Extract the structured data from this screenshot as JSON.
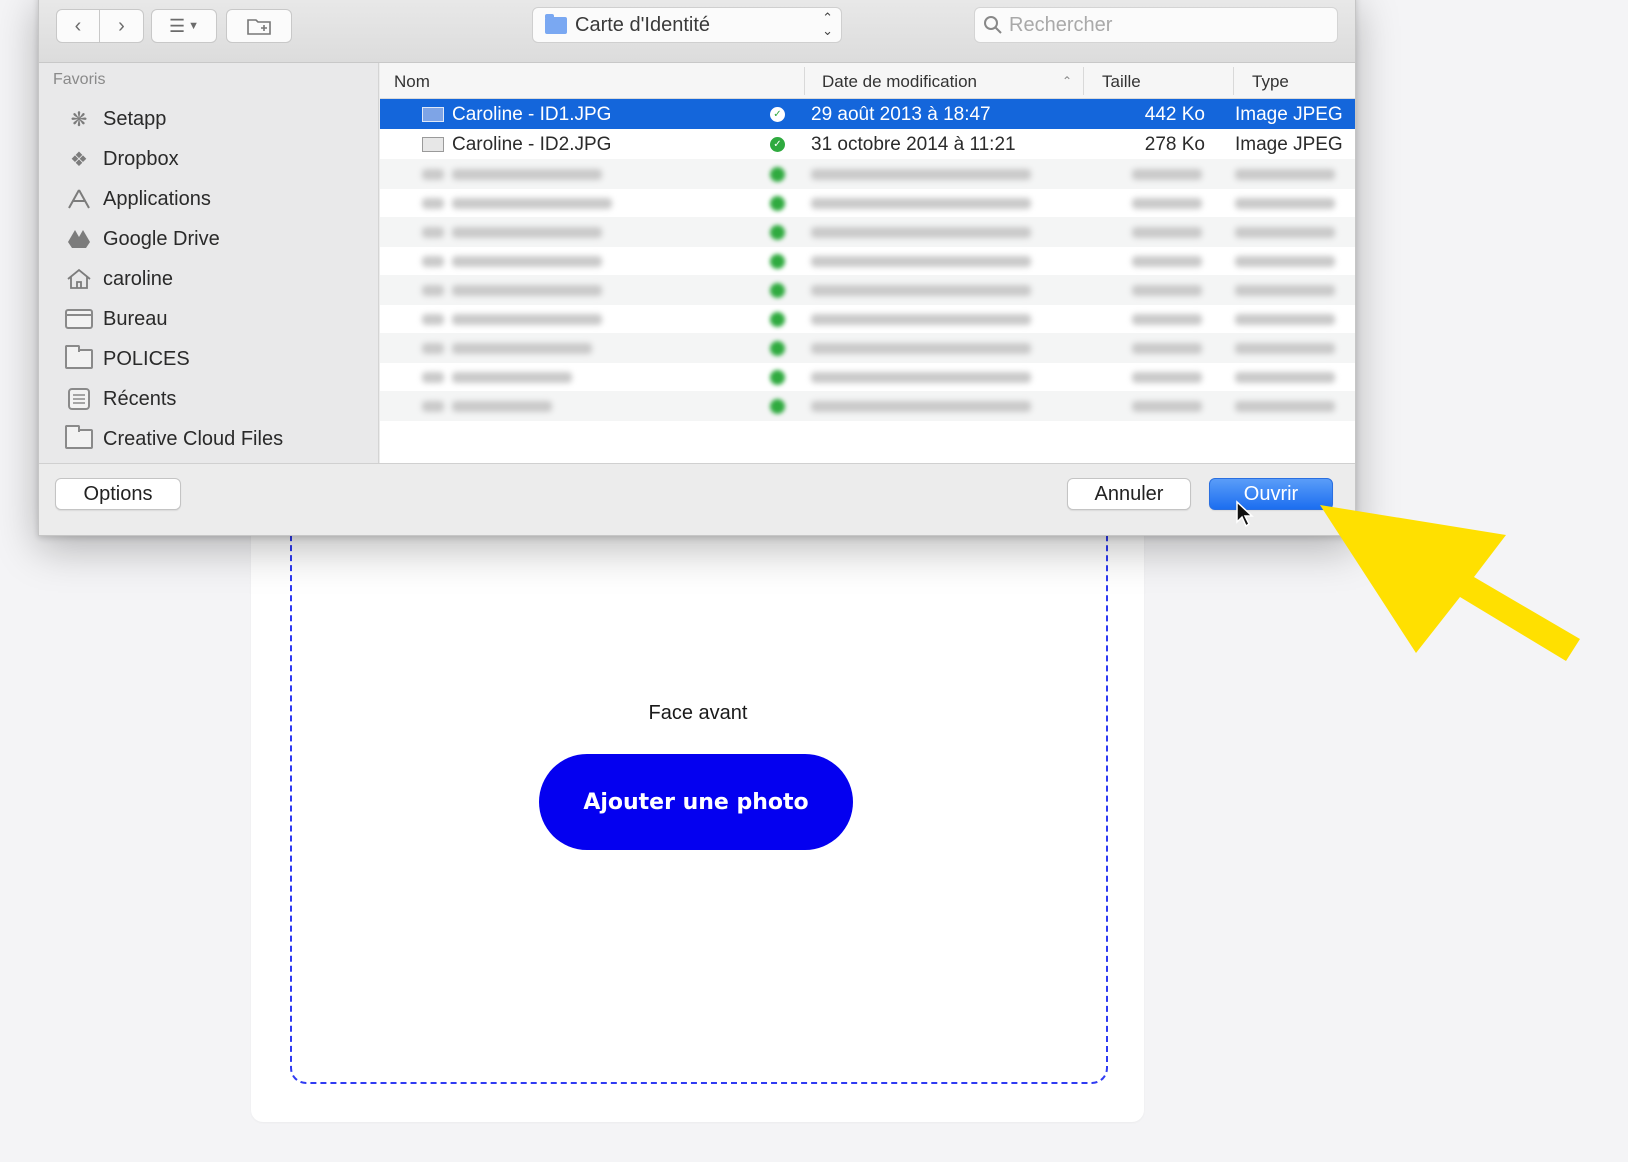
{
  "dialog": {
    "location": "Carte d'Identité",
    "search_placeholder": "Rechercher",
    "sidebar": {
      "heading": "Favoris",
      "items": [
        {
          "label": "Setapp",
          "icon": "setapp-icon"
        },
        {
          "label": "Dropbox",
          "icon": "dropbox-icon"
        },
        {
          "label": "Applications",
          "icon": "applications-icon"
        },
        {
          "label": "Google Drive",
          "icon": "google-drive-icon"
        },
        {
          "label": "caroline",
          "icon": "home-icon"
        },
        {
          "label": "Bureau",
          "icon": "desktop-icon"
        },
        {
          "label": "POLICES",
          "icon": "folder-icon"
        },
        {
          "label": "Récents",
          "icon": "recents-icon"
        },
        {
          "label": "Creative Cloud Files",
          "icon": "folder-icon"
        }
      ]
    },
    "columns": {
      "name": "Nom",
      "date": "Date de modification",
      "size": "Taille",
      "kind": "Type"
    },
    "files": [
      {
        "name": "Caroline - ID1.JPG",
        "date": "29 août 2013 à 18:47",
        "size": "442 Ko",
        "kind": "Image JPEG",
        "selected": true
      },
      {
        "name": "Caroline - ID2.JPG",
        "date": "31 octobre 2014 à 11:21",
        "size": "278 Ko",
        "kind": "Image JPEG",
        "selected": false
      }
    ],
    "blurred_row_count": 9,
    "buttons": {
      "options": "Options",
      "cancel": "Annuler",
      "open": "Ouvrir"
    }
  },
  "page": {
    "face_label": "Face avant",
    "add_photo": "Ajouter une photo"
  },
  "colors": {
    "selection": "#1466db",
    "primary_button": "#0400f0",
    "annotation_arrow": "#ffe000",
    "sync_badge": "#2faa3f"
  }
}
